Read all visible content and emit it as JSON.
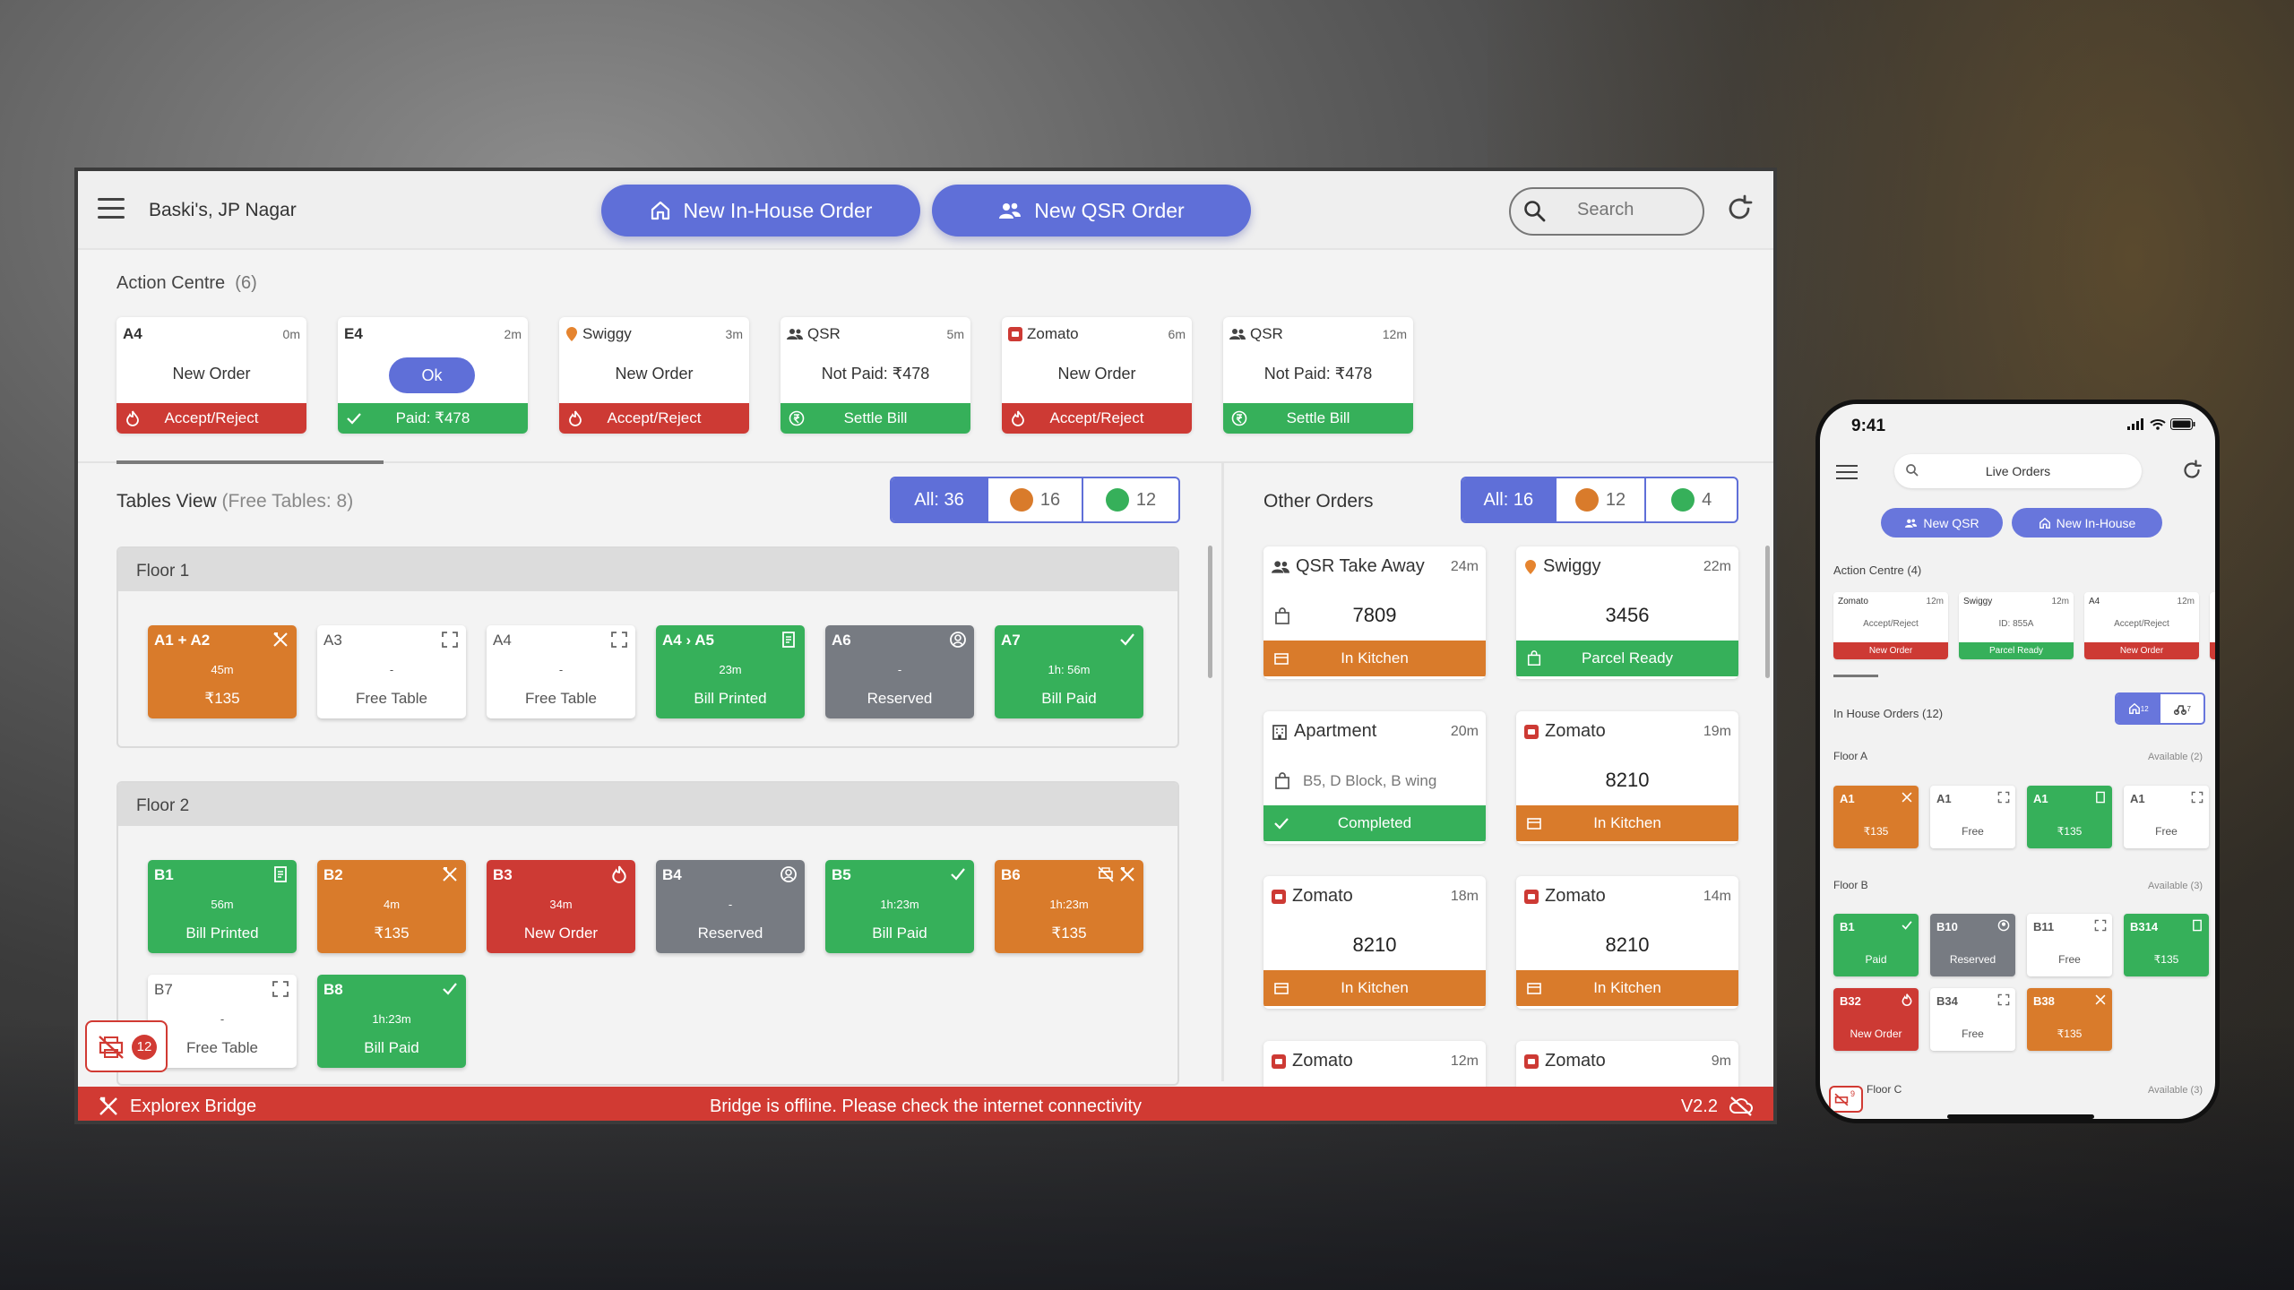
{
  "colors": {
    "accent": "#5f6fd8",
    "red": "#cd3a34",
    "green": "#36b05a",
    "orange": "#d97b2b",
    "grey": "#777b82"
  },
  "header": {
    "venue": "Baski's, JP Nagar",
    "new_inhouse": "New In-House Order",
    "new_qsr": "New QSR Order",
    "search_placeholder": "Search"
  },
  "action_centre": {
    "title": "Action Centre",
    "count": "(6)",
    "cards": [
      {
        "name": "A4",
        "time": "0m",
        "middle": "New Order",
        "footer": "Accept/Reject",
        "footer_color": "red",
        "icon": "none"
      },
      {
        "name": "E4",
        "time": "2m",
        "middle": "Ok",
        "footer": "Paid: ₹478",
        "footer_color": "green",
        "icon": "none"
      },
      {
        "name": "Swiggy",
        "time": "3m",
        "middle": "New Order",
        "footer": "Accept/Reject",
        "footer_color": "red",
        "icon": "swiggy-icon"
      },
      {
        "name": "QSR",
        "time": "5m",
        "middle": "Not Paid: ₹478",
        "footer": "Settle Bill",
        "footer_color": "green",
        "icon": "qsr-icon"
      },
      {
        "name": "Zomato",
        "time": "6m",
        "middle": "New Order",
        "footer": "Accept/Reject",
        "footer_color": "red",
        "icon": "zomato-icon"
      },
      {
        "name": "QSR",
        "time": "12m",
        "middle": "Not Paid: ₹478",
        "footer": "Settle Bill",
        "footer_color": "green",
        "icon": "qsr-icon"
      }
    ]
  },
  "tables_view": {
    "title": "Tables View",
    "free": "(Free Tables: 8)",
    "filter_all": "All: 36",
    "filter_orange": "16",
    "filter_green": "12",
    "floors": [
      {
        "name": "Floor 1",
        "tables": [
          {
            "name": "A1 + A2",
            "status": "orange",
            "time": "45m",
            "value": "₹135",
            "icon": "cutlery-icon"
          },
          {
            "name": "A3",
            "status": "free",
            "time": "-",
            "value": "Free Table",
            "icon": "expand-icon"
          },
          {
            "name": "A4",
            "status": "free",
            "time": "-",
            "value": "Free Table",
            "icon": "expand-icon"
          },
          {
            "name": "A4 › A5",
            "status": "green",
            "time": "23m",
            "value": "Bill Printed",
            "icon": "receipt-icon"
          },
          {
            "name": "A6",
            "status": "grey",
            "time": "-",
            "value": "Reserved",
            "icon": "person-icon"
          },
          {
            "name": "A7",
            "status": "green",
            "time": "1h: 56m",
            "value": "Bill Paid",
            "icon": "check-icon"
          }
        ]
      },
      {
        "name": "Floor 2",
        "tables": [
          {
            "name": "B1",
            "status": "green",
            "time": "56m",
            "value": "Bill Printed",
            "icon": "receipt-icon"
          },
          {
            "name": "B2",
            "status": "orange",
            "time": "4m",
            "value": "₹135",
            "icon": "cutlery-icon"
          },
          {
            "name": "B3",
            "status": "red",
            "time": "34m",
            "value": "New Order",
            "icon": "flame-icon"
          },
          {
            "name": "B4",
            "status": "grey",
            "time": "-",
            "value": "Reserved",
            "icon": "person-icon"
          },
          {
            "name": "B5",
            "status": "green",
            "time": "1h:23m",
            "value": "Bill Paid",
            "icon": "check-icon"
          },
          {
            "name": "B6",
            "status": "orange",
            "time": "1h:23m",
            "value": "₹135",
            "icon": "printer-off-icon"
          },
          {
            "name": "B7",
            "status": "free",
            "time": "-",
            "value": "Free Table",
            "icon": "expand-icon"
          },
          {
            "name": "B8",
            "status": "green",
            "time": "1h:23m",
            "value": "Bill Paid",
            "icon": "check-icon"
          }
        ]
      }
    ]
  },
  "other_orders": {
    "title": "Other Orders",
    "filter_all": "All: 16",
    "filter_orange": "12",
    "filter_green": "4",
    "orders": [
      {
        "source": "QSR Take Away",
        "time": "24m",
        "value": "7809",
        "footer": "In Kitchen",
        "footer_color": "orange",
        "icon": "qsr-icon"
      },
      {
        "source": "Swiggy",
        "time": "22m",
        "value": "3456",
        "footer": "Parcel Ready",
        "footer_color": "green",
        "icon": "swiggy-icon"
      },
      {
        "source": "Apartment",
        "time": "20m",
        "value": "B5, D Block, B wing",
        "footer": "Completed",
        "footer_color": "green",
        "icon": "building-icon"
      },
      {
        "source": "Zomato",
        "time": "19m",
        "value": "8210",
        "footer": "In Kitchen",
        "footer_color": "orange",
        "icon": "zomato-icon"
      },
      {
        "source": "Zomato",
        "time": "18m",
        "value": "8210",
        "footer": "In Kitchen",
        "footer_color": "orange",
        "icon": "zomato-icon"
      },
      {
        "source": "Zomato",
        "time": "14m",
        "value": "8210",
        "footer": "In Kitchen",
        "footer_color": "orange",
        "icon": "zomato-icon"
      },
      {
        "source": "Zomato",
        "time": "12m",
        "value": "",
        "footer": "",
        "footer_color": "orange",
        "icon": "zomato-icon"
      },
      {
        "source": "Zomato",
        "time": "9m",
        "value": "",
        "footer": "",
        "footer_color": "orange",
        "icon": "zomato-icon"
      }
    ]
  },
  "printer_badge": "12",
  "bottom_bar": {
    "brand": "Explorex Bridge",
    "message": "Bridge is offline. Please check the internet connectivity",
    "version": "V2.2"
  },
  "phone": {
    "time": "9:41",
    "search": "Live Orders",
    "new_qsr": "New QSR",
    "new_inhouse": "New In-House",
    "action_centre": "Action Centre (4)",
    "ac_cards": [
      {
        "name": "Zomato",
        "time": "12m",
        "middle": "Accept/Reject",
        "footer": "New Order",
        "color": "red"
      },
      {
        "name": "Swiggy",
        "time": "12m",
        "middle": "ID: 855A",
        "footer": "Parcel Ready",
        "color": "green"
      },
      {
        "name": "A4",
        "time": "12m",
        "middle": "Accept/Reject",
        "footer": "New Order",
        "color": "red"
      }
    ],
    "in_house": "In House Orders (12)",
    "toggle_a": "12",
    "toggle_b": "7",
    "floor_a": "Floor A",
    "floor_a_avail": "Available (2)",
    "floor_b": "Floor B",
    "floor_b_avail": "Available (3)",
    "floor_c": "Floor C",
    "floor_c_avail": "Available (3)",
    "tables_a": [
      {
        "name": "A1",
        "status": "orange",
        "value": "₹135",
        "icon": "cutlery"
      },
      {
        "name": "A1",
        "status": "free",
        "value": "Free",
        "icon": "expand"
      },
      {
        "name": "A1",
        "status": "green",
        "value": "₹135",
        "icon": "receipt"
      },
      {
        "name": "A1",
        "status": "free",
        "value": "Free",
        "icon": "expand"
      }
    ],
    "tables_b": [
      {
        "name": "B1",
        "status": "green",
        "value": "Paid",
        "icon": "check"
      },
      {
        "name": "B10",
        "status": "grey",
        "value": "Reserved",
        "icon": "person"
      },
      {
        "name": "B11",
        "status": "free",
        "value": "Free",
        "icon": "expand"
      },
      {
        "name": "B314",
        "status": "green",
        "value": "₹135",
        "icon": "receipt"
      },
      {
        "name": "B32",
        "status": "red",
        "value": "New Order",
        "icon": "flame"
      },
      {
        "name": "B34",
        "status": "free",
        "value": "Free",
        "icon": "expand"
      },
      {
        "name": "B38",
        "status": "orange",
        "value": "₹135",
        "icon": "cutlery"
      }
    ],
    "printer_badge": "9"
  }
}
